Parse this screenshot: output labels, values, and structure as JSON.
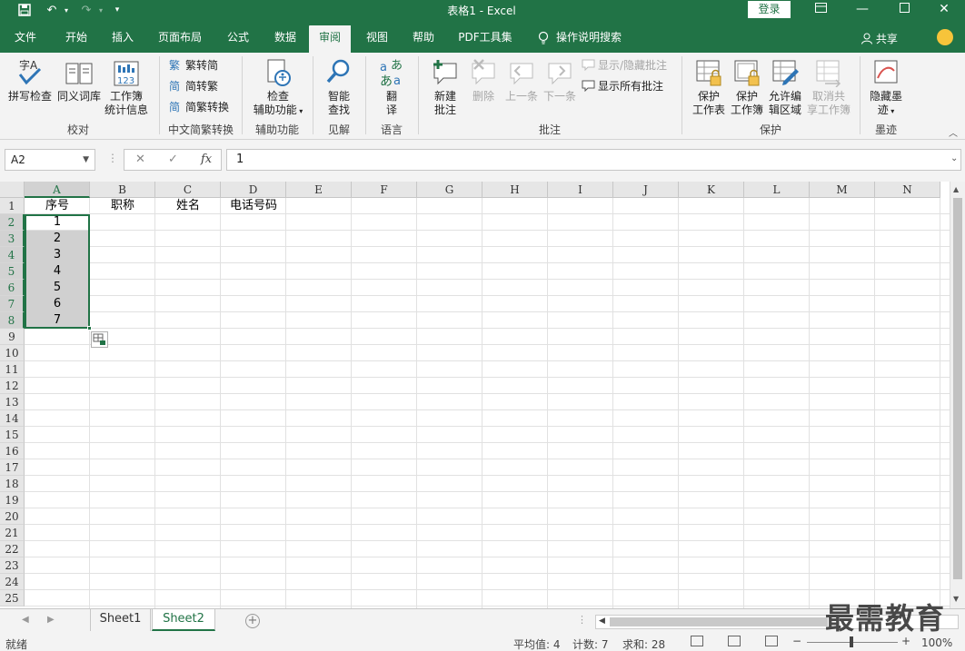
{
  "titlebar": {
    "title": "表格1  -  Excel",
    "login": "登录"
  },
  "tabs": [
    "文件",
    "开始",
    "插入",
    "页面布局",
    "公式",
    "数据",
    "审阅",
    "视图",
    "帮助",
    "PDF工具集",
    "操作说明搜索"
  ],
  "active_tab": "审阅",
  "share": "共享",
  "ribbon": {
    "spelling": "拼写检查",
    "thesaurus": "同义词库",
    "workbook_stats_1": "工作簿",
    "workbook_stats_2": "统计信息",
    "group_proofing": "校对",
    "trad_to_simp": "繁转简",
    "simp_to_trad": "简转繁",
    "convert": "简繁转换",
    "group_chinese": "中文简繁转换",
    "check_access_1": "检查",
    "check_access_2": "辅助功能",
    "group_access": "辅助功能",
    "smart_lookup_1": "智能",
    "smart_lookup_2": "查找",
    "group_insights": "见解",
    "translate_1": "翻",
    "translate_2": "译",
    "group_language": "语言",
    "new_comment_1": "新建",
    "new_comment_2": "批注",
    "delete": "删除",
    "previous": "上一条",
    "next": "下一条",
    "show_hide_comment": "显示/隐藏批注",
    "show_all_comments": "显示所有批注",
    "group_comments": "批注",
    "protect_sheet_1": "保护",
    "protect_sheet_2": "工作表",
    "protect_workbook_1": "保护",
    "protect_workbook_2": "工作簿",
    "allow_edit_1": "允许编",
    "allow_edit_2": "辑区域",
    "unshare_1": "取消共",
    "unshare_2": "享工作簿",
    "group_protect": "保护",
    "hide_ink_1": "隐藏墨",
    "hide_ink_2": "迹",
    "group_ink": "墨迹"
  },
  "formula_bar": {
    "name_box": "A2",
    "cancel": "✕",
    "enter": "✓",
    "fx": "fx",
    "content": "1"
  },
  "columns": [
    "A",
    "B",
    "C",
    "D",
    "E",
    "F",
    "G",
    "H",
    "I",
    "J",
    "K",
    "L",
    "M",
    "N"
  ],
  "rows": [
    "1",
    "2",
    "3",
    "4",
    "5",
    "6",
    "7",
    "8",
    "9",
    "10",
    "11",
    "12",
    "13",
    "14",
    "15",
    "16",
    "17",
    "18",
    "19",
    "20",
    "21",
    "22",
    "23",
    "24",
    "25"
  ],
  "header_row": [
    "序号",
    "职称",
    "姓名",
    "电话号码"
  ],
  "column_a_values": [
    "1",
    "2",
    "3",
    "4",
    "5",
    "6",
    "7"
  ],
  "sheets": [
    "Sheet1",
    "Sheet2"
  ],
  "active_sheet": "Sheet2",
  "status": {
    "ready": "就绪",
    "average": "平均值: 4",
    "count": "计数: 7",
    "sum": "求和: 28",
    "zoom": "100%"
  },
  "watermark": "最需教育",
  "colors": {
    "excel_green": "#217346",
    "selection_fill": "#d0d0d0",
    "header_gray": "#e6e6e6"
  }
}
